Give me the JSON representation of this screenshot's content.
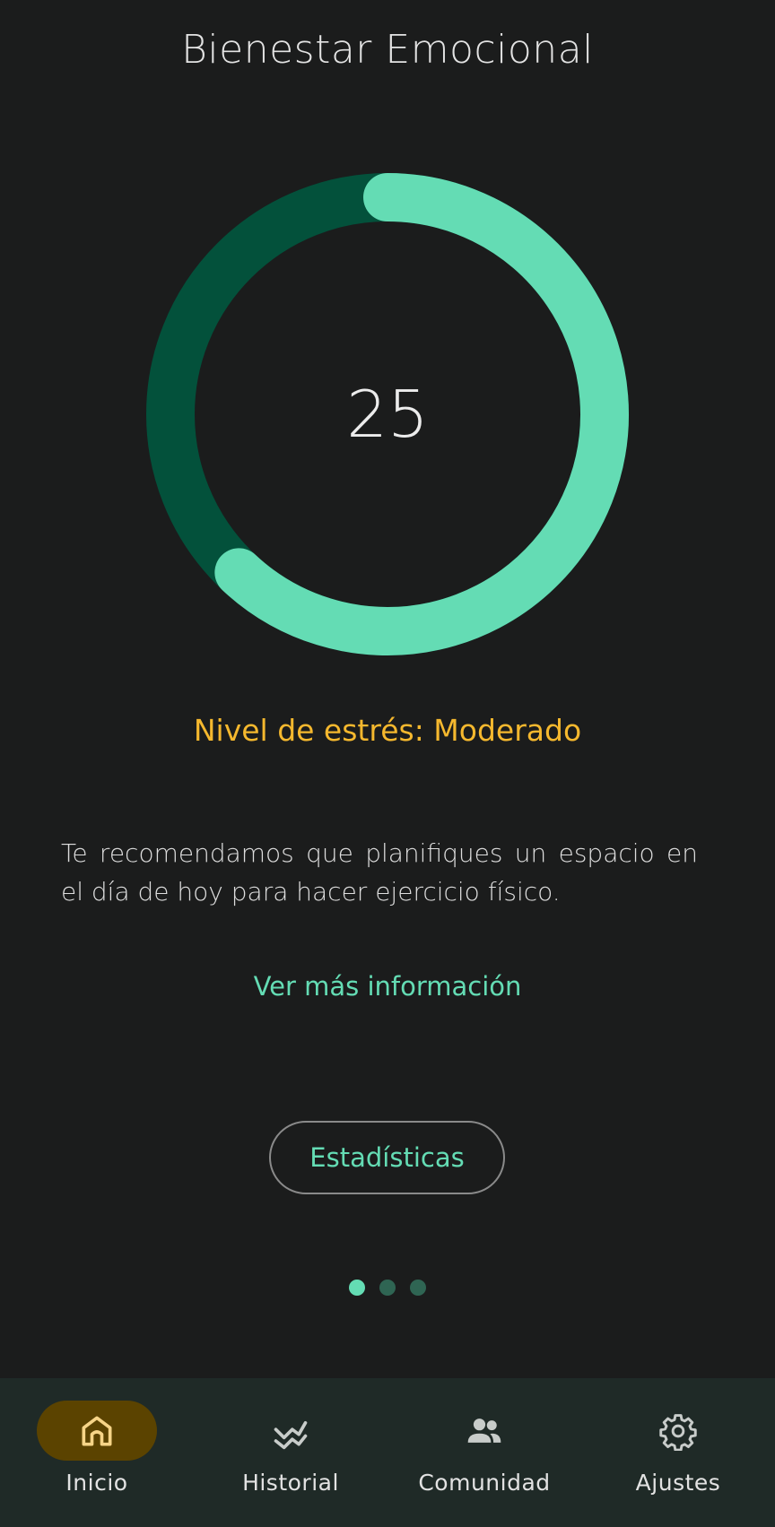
{
  "header": {
    "title": "Bienestar Emocional"
  },
  "gauge": {
    "value": "25",
    "fill_fraction": 0.62,
    "track_color": "#03513b",
    "fill_color": "#64dcb4"
  },
  "stress": {
    "label": "Nivel de estrés: Moderado",
    "color": "#f5b82e"
  },
  "recommendation": {
    "text": "Te recomendamos que planifiques un espacio en el día de hoy para hacer ejercicio físico."
  },
  "more_info": {
    "label": "Ver más información"
  },
  "stats_button": {
    "label": "Estadísticas"
  },
  "pager": {
    "count": 3,
    "active_index": 0
  },
  "nav": {
    "items": [
      {
        "label": "Inicio",
        "icon": "home-icon",
        "active": true
      },
      {
        "label": "Historial",
        "icon": "history-chart-icon",
        "active": false
      },
      {
        "label": "Comunidad",
        "icon": "people-icon",
        "active": false
      },
      {
        "label": "Ajustes",
        "icon": "gear-icon",
        "active": false
      }
    ]
  }
}
